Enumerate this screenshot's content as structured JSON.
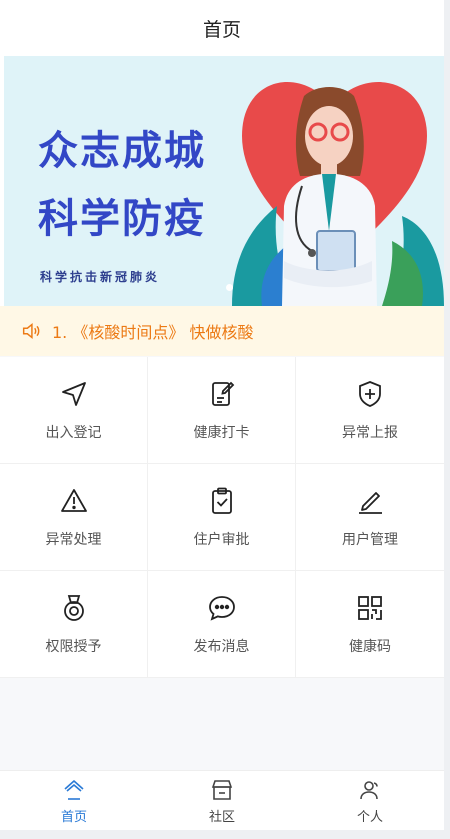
{
  "header": {
    "title": "首页"
  },
  "banner": {
    "line1": "众志成城",
    "line2": "科学防疫",
    "subline": "科学抗击新冠肺炎",
    "colors": {
      "bg": "#dff3f8",
      "heart": "#e84a4a",
      "text": "#3247c6"
    }
  },
  "notice": {
    "text": "1. 《核酸时间点》 快做核酸",
    "color": "#ec7a15"
  },
  "grid": {
    "items": [
      {
        "label": "出入登记",
        "icon": "navigation-arrow-icon"
      },
      {
        "label": "健康打卡",
        "icon": "clipboard-edit-icon"
      },
      {
        "label": "异常上报",
        "icon": "shield-plus-icon"
      },
      {
        "label": "异常处理",
        "icon": "warning-triangle-icon"
      },
      {
        "label": "住户审批",
        "icon": "clipboard-check-icon"
      },
      {
        "label": "用户管理",
        "icon": "pencil-line-icon"
      },
      {
        "label": "权限授予",
        "icon": "medal-icon"
      },
      {
        "label": "发布消息",
        "icon": "chat-bubble-icon"
      },
      {
        "label": "健康码",
        "icon": "qrcode-icon"
      }
    ]
  },
  "tabbar": {
    "active_color": "#2a7ad6",
    "items": [
      {
        "label": "首页",
        "icon": "home-icon"
      },
      {
        "label": "社区",
        "icon": "community-store-icon"
      },
      {
        "label": "个人",
        "icon": "user-icon"
      }
    ]
  }
}
